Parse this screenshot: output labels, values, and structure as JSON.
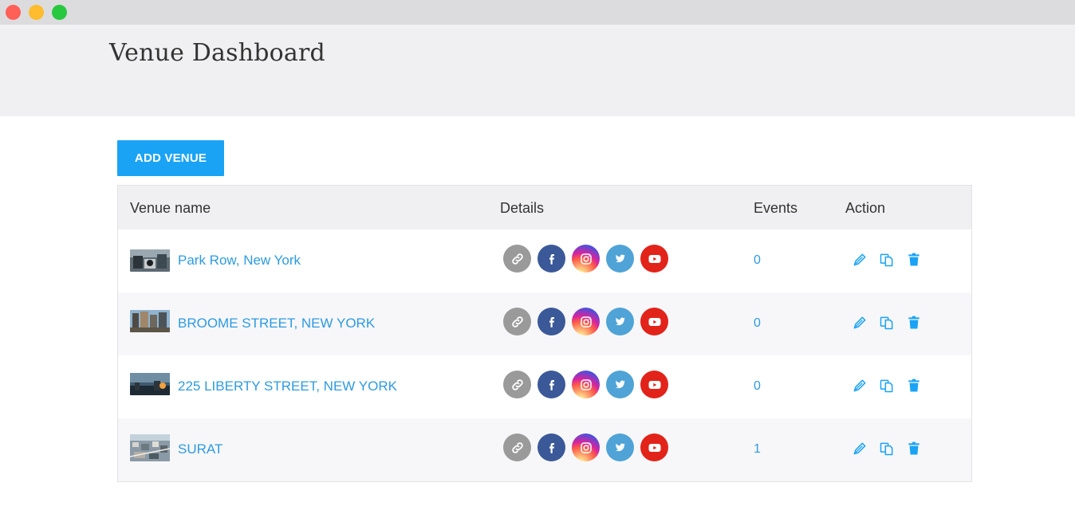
{
  "header": {
    "title": "Venue Dashboard"
  },
  "toolbar": {
    "add_label": "ADD VENUE"
  },
  "table": {
    "columns": [
      "Venue name",
      "Details",
      "Events",
      "Action"
    ],
    "rows": [
      {
        "name": "Park Row, New York",
        "events": "0",
        "thumb": "city-street-photo"
      },
      {
        "name": "BROOME STREET, NEW YORK",
        "events": "0",
        "thumb": "building-photo"
      },
      {
        "name": "225 LIBERTY STREET, NEW YORK",
        "events": "0",
        "thumb": "sunset-skyline-photo"
      },
      {
        "name": "SURAT",
        "events": "1",
        "thumb": "aerial-city-photo"
      }
    ]
  },
  "icons": {
    "details": [
      "link-icon",
      "facebook-icon",
      "instagram-icon",
      "twitter-icon",
      "youtube-icon"
    ],
    "actions": [
      "edit-icon",
      "duplicate-icon",
      "delete-icon"
    ]
  },
  "colors": {
    "accent": "#1aa3f5",
    "link": "#2d9be0",
    "facebook": "#3b5998",
    "twitter": "#4fa3d6",
    "youtube": "#e2231a",
    "link_icon_bg": "#9a9a9a"
  }
}
